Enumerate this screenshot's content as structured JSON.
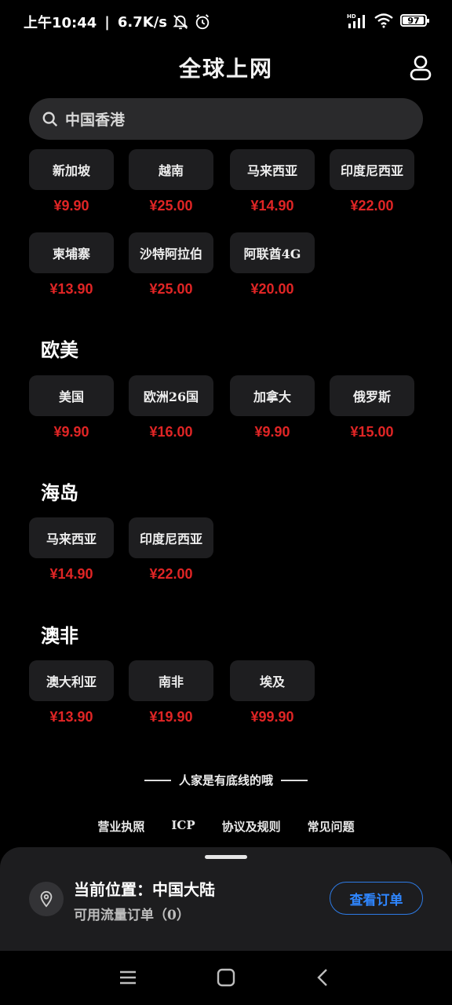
{
  "status_bar": {
    "time": "上午10:44",
    "speed": "6.7K/s",
    "battery": "97",
    "battery_pct": 97
  },
  "header": {
    "title": "全球上网"
  },
  "search": {
    "value": "中国香港"
  },
  "partial_grid": [
    {
      "name": "新加坡",
      "price": "¥9.90"
    },
    {
      "name": "越南",
      "price": "¥25.00"
    },
    {
      "name": "马来西亚",
      "price": "¥14.90"
    },
    {
      "name": "印度尼西亚",
      "price": "¥22.00"
    },
    {
      "name": "柬埔寨",
      "price": "¥13.90"
    },
    {
      "name": "沙特阿拉伯",
      "price": "¥25.00"
    },
    {
      "name": "阿联酋4G",
      "price": "¥20.00"
    }
  ],
  "sections": [
    {
      "title": "欧美",
      "items": [
        {
          "name": "美国",
          "price": "¥9.90"
        },
        {
          "name": "欧洲26国",
          "price": "¥16.00"
        },
        {
          "name": "加拿大",
          "price": "¥9.90"
        },
        {
          "name": "俄罗斯",
          "price": "¥15.00"
        }
      ]
    },
    {
      "title": "海岛",
      "items": [
        {
          "name": "马来西亚",
          "price": "¥14.90"
        },
        {
          "name": "印度尼西亚",
          "price": "¥22.00"
        }
      ]
    },
    {
      "title": "澳非",
      "items": [
        {
          "name": "澳大利亚",
          "price": "¥13.90"
        },
        {
          "name": "南非",
          "price": "¥19.90"
        },
        {
          "name": "埃及",
          "price": "¥99.90"
        }
      ]
    }
  ],
  "footer": {
    "note": "人家是有底线的哦",
    "links": [
      "营业执照",
      "ICP",
      "协议及规则",
      "常见问题"
    ]
  },
  "bottom_sheet": {
    "location": "当前位置：中国大陆",
    "orders_available": "可用流量订单（0）",
    "view_orders": "查看订单"
  },
  "colors": {
    "price": "#e02525",
    "accent": "#2f86ff",
    "card": "#1e1e20"
  }
}
